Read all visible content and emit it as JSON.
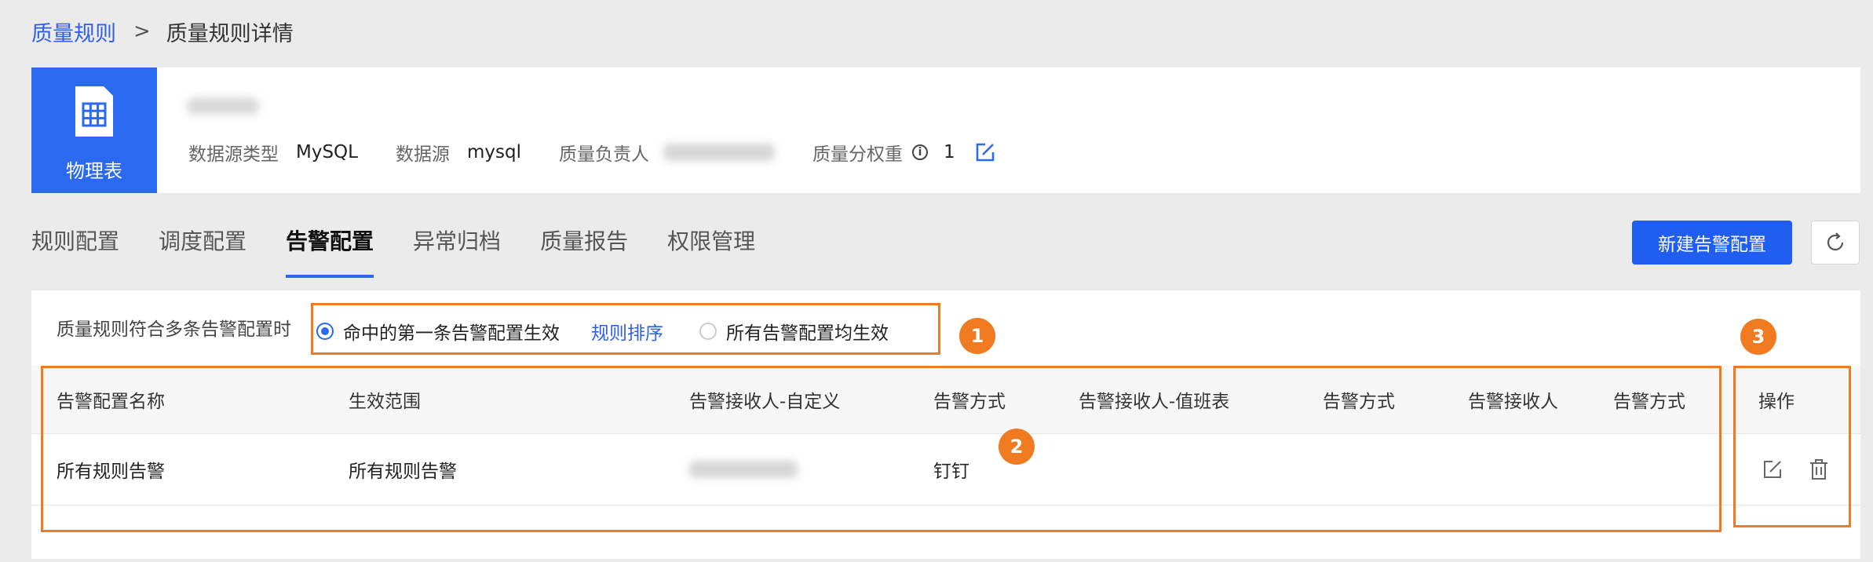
{
  "breadcrumb": {
    "parent": "质量规则",
    "separator": ">",
    "current": "质量规则详情"
  },
  "table_info": {
    "type_label": "物理表",
    "fields": {
      "source_type_label": "数据源类型",
      "source_type_value": "MySQL",
      "source_label": "数据源",
      "source_value": "mysql",
      "owner_label": "质量负责人",
      "weight_label": "质量分权重",
      "weight_value": "1"
    }
  },
  "tabs": [
    "规则配置",
    "调度配置",
    "告警配置",
    "异常归档",
    "质量报告",
    "权限管理"
  ],
  "active_tab": "告警配置",
  "actions": {
    "new_button": "新建告警配置"
  },
  "alert_mode": {
    "label": "质量规则符合多条告警配置时",
    "option_first": "命中的第一条告警配置生效",
    "sort_link": "规则排序",
    "option_all": "所有告警配置均生效",
    "selected": "option_first"
  },
  "table": {
    "headers": [
      "告警配置名称",
      "生效范围",
      "告警接收人-自定义",
      "告警方式",
      "告警接收人-值班表",
      "告警方式",
      "告警接收人",
      "告警方式",
      "操作"
    ],
    "rows": [
      {
        "name": "所有规则告警",
        "scope": "所有规则告警",
        "method_custom": "钉钉"
      }
    ]
  },
  "annotations": [
    "1",
    "2",
    "3"
  ],
  "colors": {
    "primary": "#1f5ef0",
    "highlight": "#f07a1f",
    "link": "#2f5fe8"
  }
}
